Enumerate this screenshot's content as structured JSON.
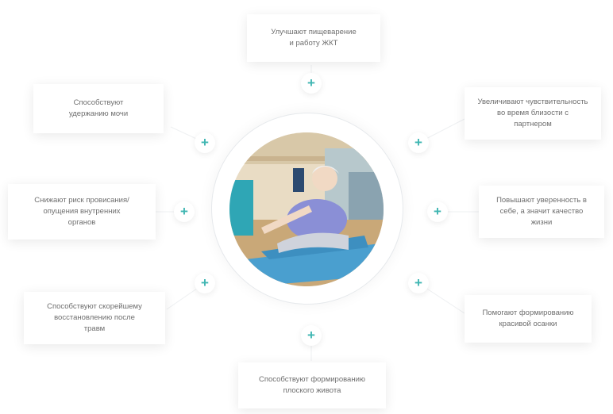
{
  "diagram": {
    "center_image": "woman-stretching-on-yoga-mat",
    "accent_color": "#3fb6b2",
    "plus_glyph": "+",
    "benefits": [
      {
        "id": "top",
        "text": "Улучшают пищеварение\nи работу ЖКТ"
      },
      {
        "id": "top-right",
        "text": "Увеличивают чувствительность\nво время близости с\nпартнером"
      },
      {
        "id": "right",
        "text": "Повышают уверенность в\nсебе, а значит качество\nжизни"
      },
      {
        "id": "bottom-right",
        "text": "Помогают формированию\nкрасивой осанки"
      },
      {
        "id": "bottom",
        "text": "Способствуют формированию\nплоского живота"
      },
      {
        "id": "bottom-left",
        "text": "Способствуют скорейшему\nвосстановлению после\nтравм"
      },
      {
        "id": "left",
        "text": "Снижают риск провисания/\nопущения внутренних\nорганов"
      },
      {
        "id": "top-left",
        "text": "Способствуют\nудержанию мочи"
      }
    ]
  }
}
